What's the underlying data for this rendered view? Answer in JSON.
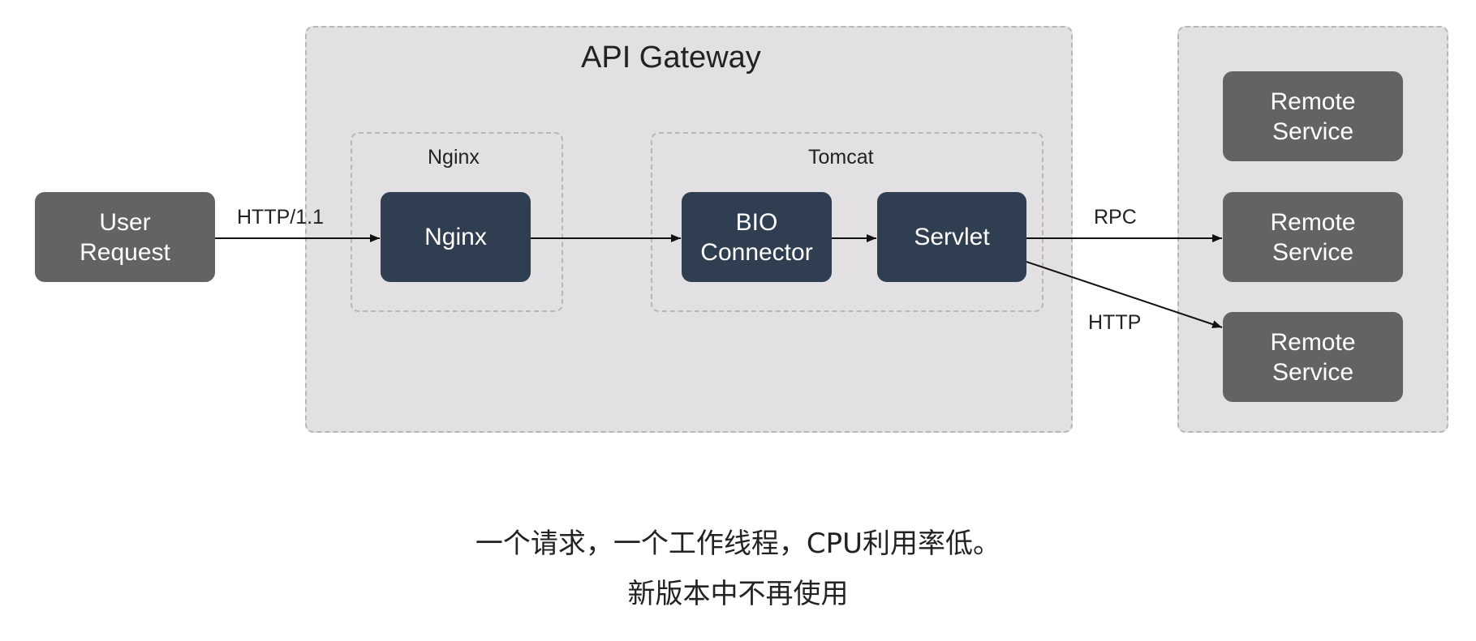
{
  "diagram": {
    "gateway_title": "API Gateway",
    "nginx_group_label": "Nginx",
    "tomcat_group_label": "Tomcat",
    "nodes": {
      "user_request": "User\nRequest",
      "nginx": "Nginx",
      "bio_connector": "BIO\nConnector",
      "servlet": "Servlet",
      "remote_service_1": "Remote\nService",
      "remote_service_2": "Remote\nService",
      "remote_service_3": "Remote\nService"
    },
    "edge_labels": {
      "http11": "HTTP/1.1",
      "rpc": "RPC",
      "http": "HTTP"
    },
    "edges": [
      {
        "from": "user_request",
        "to": "nginx",
        "label": "HTTP/1.1"
      },
      {
        "from": "nginx",
        "to": "bio_connector",
        "label": ""
      },
      {
        "from": "bio_connector",
        "to": "servlet",
        "label": ""
      },
      {
        "from": "servlet",
        "to": "remote_service_2",
        "label": "RPC"
      },
      {
        "from": "servlet",
        "to": "remote_service_3",
        "label": "HTTP"
      }
    ]
  },
  "captions": {
    "line1": "一个请求，一个工作线程，CPU利用率低。",
    "line2": "新版本中不再使用"
  },
  "colors": {
    "region_fill": "#e2e0e3",
    "region_border": "#b8b6b9",
    "grey_node": "#636363",
    "dark_node": "#303e52",
    "arrow": "#111111"
  }
}
